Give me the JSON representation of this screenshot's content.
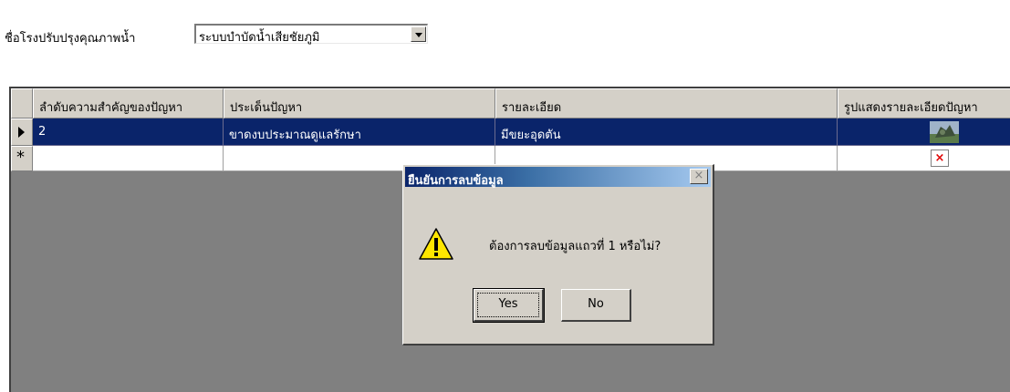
{
  "form": {
    "plant_label": "ชื่อโรงปรับปรุงคุณภาพน้ำ",
    "plant_select_value": "ระบบบำบัดน้ำเสียชัยภูมิ"
  },
  "grid": {
    "columns": [
      "ลำดับความสำคัญของปัญหา",
      "ประเด็นปัญหา",
      "รายละเอียด",
      "รูปแสดงรายละเอียดปัญหา"
    ],
    "rows": [
      {
        "priority": "2",
        "issue": "ขาดงบประมาณดูแลรักษา",
        "detail": "มีขยะอุดตัน",
        "image": "thumbnail-photo"
      }
    ],
    "new_row_marker": "*",
    "selected_row_indicator": "arrow-right-icon",
    "broken_image_icon": "broken-image-icon"
  },
  "dialog": {
    "title": "ยืนยันการลบข้อมูล",
    "message": "ต้องการลบข้อมูลแถวที่ 1 หรือไม่?",
    "yes_label": "Yes",
    "no_label": "No",
    "icon": "warning-icon",
    "close_icon": "close-icon"
  },
  "colors": {
    "selection": "#0a246a",
    "grid_bg": "#808080",
    "face": "#d4d0c8"
  }
}
